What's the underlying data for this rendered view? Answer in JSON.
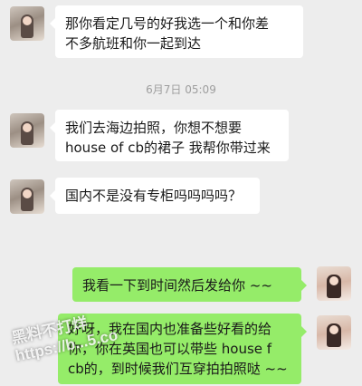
{
  "messages": [
    {
      "side": "in",
      "lines": [
        "那你看定几号的好我选一个和你差",
        "不多航班和你一起到达"
      ]
    },
    {
      "timestamp": "6月7日 05:09"
    },
    {
      "side": "in",
      "lines": [
        "我们去海边拍照，你想不想要",
        "house of cb的裙子 我帮你带过来"
      ]
    },
    {
      "side": "in",
      "lines": [
        "国内不是没有专柜吗吗吗吗？"
      ]
    },
    {
      "side": "out",
      "lines": [
        "我看一下到时间然后发给你 ~~"
      ]
    },
    {
      "side": "out",
      "lines": [
        "好呀，我在国内也准备些好看的给",
        "你，你在英国也可以带些 house f",
        "cb的，到时候我们互穿拍拍照哒 ~~"
      ]
    }
  ],
  "watermark": [
    "黑料不打烊",
    "https://b...5.co"
  ]
}
